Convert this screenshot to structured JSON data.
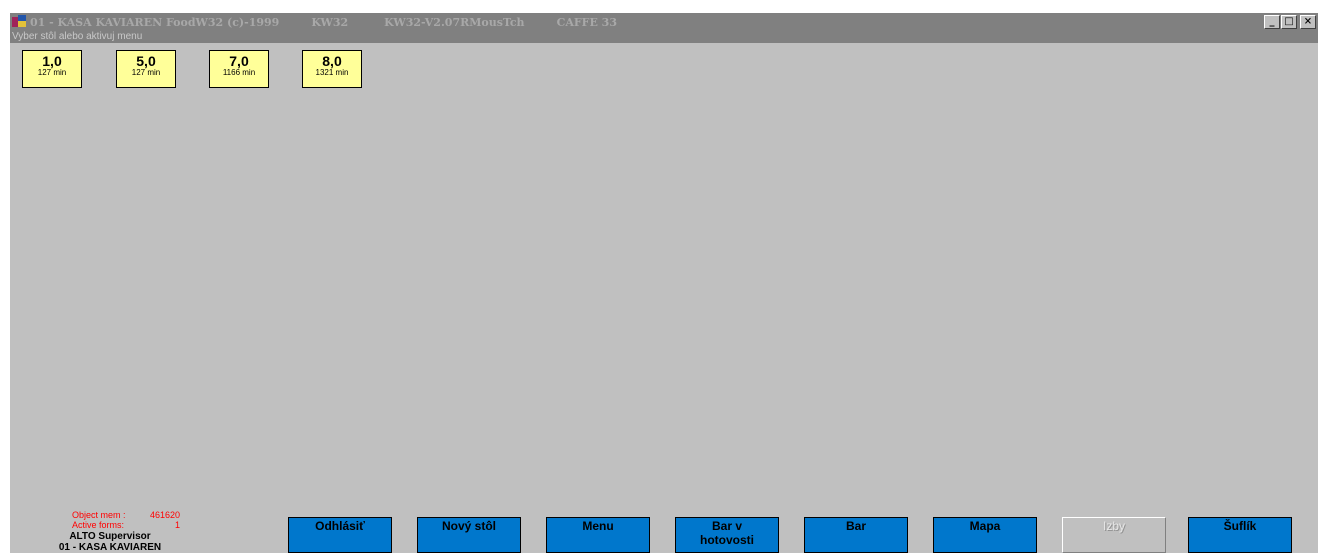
{
  "window": {
    "title_parts": [
      "01 - KASA KAVIAREN FoodW32 (c)-1999",
      "KW32",
      "KW32-V2.07RMousTch",
      "CAFFE 33"
    ],
    "controls": {
      "minimize": "_",
      "restore": "□",
      "close": "×"
    }
  },
  "hint": "Vyber stôl alebo aktivuj menu",
  "tables": [
    {
      "number": "1,0",
      "time": "127 min"
    },
    {
      "number": "5,0",
      "time": "127 min"
    },
    {
      "number": "7,0",
      "time": "1166 min"
    },
    {
      "number": "8,0",
      "time": "1321 min"
    }
  ],
  "status": {
    "object_mem_label": "Object mem :",
    "object_mem_value": "461620",
    "active_forms_label": "Active forms:",
    "active_forms_value": "1",
    "user": "ALTO Supervisor",
    "station": "01 - KASA KAVIAREN"
  },
  "buttons": {
    "logout": "Odhlásiť",
    "new_table": "Nový stôl",
    "menu": "Menu",
    "cash_bar": "Bar v hotovosti",
    "bar": "Bar",
    "map": "Mapa",
    "rooms": "Izby",
    "drawer": "Šuflík"
  },
  "colors": {
    "window_bg": "#c0c0c0",
    "titlebar_bg": "#808080",
    "table_tile": "#ffff99",
    "button_blue": "#0077cc",
    "status_red": "#ff0000"
  }
}
